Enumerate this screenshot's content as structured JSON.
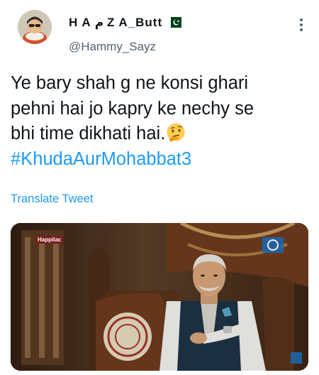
{
  "author": {
    "display_name": "H A م Z A_Butt",
    "handle": "@Hammy_Sayz",
    "flag_icon": "pakistan-flag-icon",
    "avatar_icon": "user-avatar"
  },
  "tweet": {
    "lines": [
      "Ye bary shah g ne konsi ghari",
      "pehni hai jo kapry ke nechy se",
      "bhi time dikhati hai."
    ],
    "emoji": "thinking-face-icon",
    "hashtag": "#KhudaAurMohabbat3",
    "translate_label": "Translate Tweet"
  },
  "media": {
    "channel_badge": "Happilac",
    "description_icon": "tv-drama-still"
  },
  "colors": {
    "text": "#0f1419",
    "secondary": "#536471",
    "link": "#1d9bf0"
  }
}
